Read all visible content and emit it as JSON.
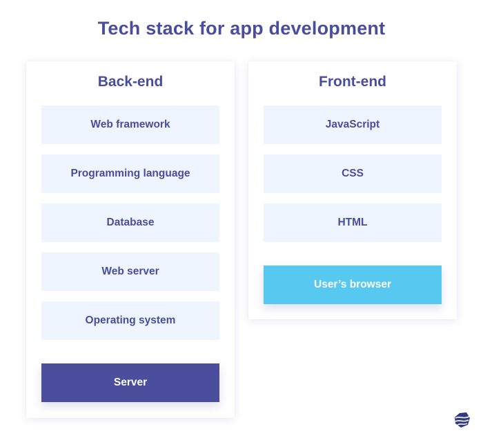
{
  "title": "Tech stack for app development",
  "colors": {
    "primary": "#4a4e9c",
    "item_bg": "#eef5fe",
    "browser": "#57c8ef"
  },
  "backend": {
    "heading": "Back-end",
    "items": [
      "Web framework",
      "Programming language",
      "Database",
      "Web server",
      "Operating system"
    ],
    "base": "Server"
  },
  "frontend": {
    "heading": "Front-end",
    "items": [
      "JavaScript",
      "CSS",
      "HTML"
    ],
    "base": "User’s browser"
  },
  "logo": {
    "icon": "brand-logo-icon"
  }
}
